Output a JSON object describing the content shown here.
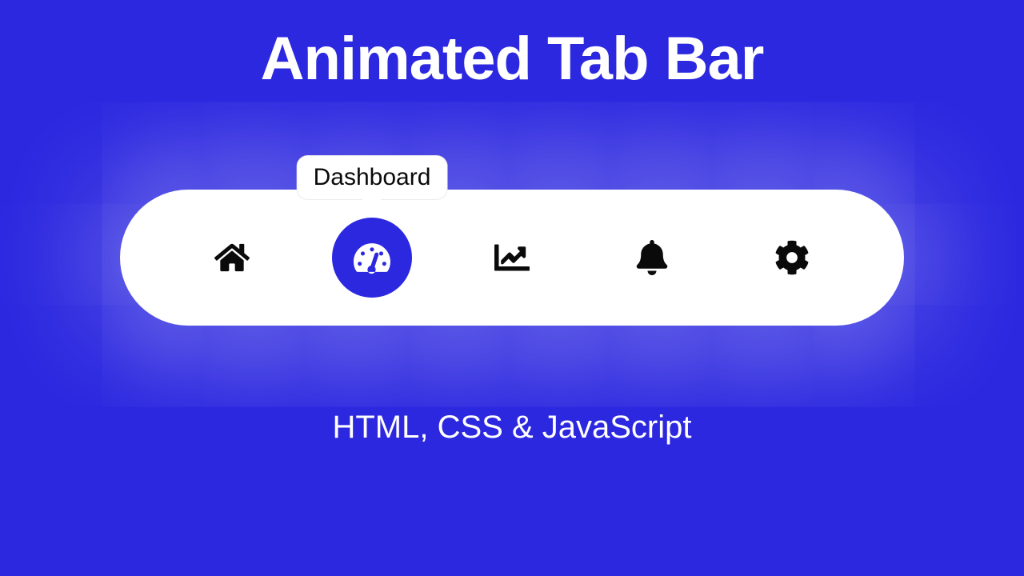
{
  "heading": "Animated Tab Bar",
  "subheading": "HTML, CSS & JavaScript",
  "tooltip": {
    "label": "Dashboard"
  },
  "tabs": [
    {
      "name": "Home"
    },
    {
      "name": "Dashboard"
    },
    {
      "name": "Analytics"
    },
    {
      "name": "Notifications"
    },
    {
      "name": "Settings"
    }
  ],
  "colors": {
    "background": "#2c28e0",
    "bar": "#ffffff",
    "icon": "#0a0a0a"
  }
}
